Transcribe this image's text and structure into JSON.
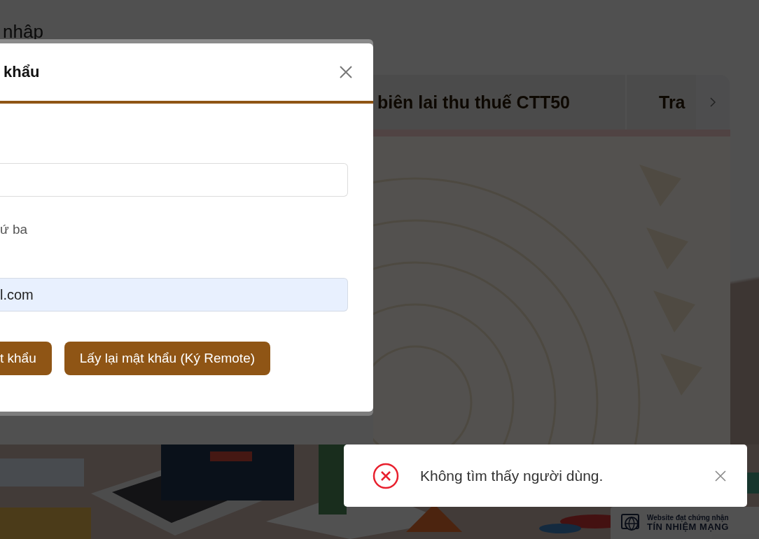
{
  "background_page": {
    "heading": "nhập",
    "tabs": [
      {
        "label": "biên lai thu thuế CTT50"
      },
      {
        "label": "Tra"
      }
    ],
    "badge": {
      "line_1": "Website đạt chứng nhận",
      "line_2": "TÍN NHIỆM MẠNG"
    }
  },
  "dialog": {
    "title": "khẩu",
    "hint": "ứ ba",
    "fields": [
      {
        "autofilled": false
      },
      {
        "autofilled": true,
        "value": "l.com"
      }
    ],
    "buttons": [
      "t khẩu",
      "Lấy lại mật khẩu (Ký Remote)"
    ]
  },
  "toast": {
    "kind": "error",
    "message": "Không tìm thấy người dùng."
  }
}
